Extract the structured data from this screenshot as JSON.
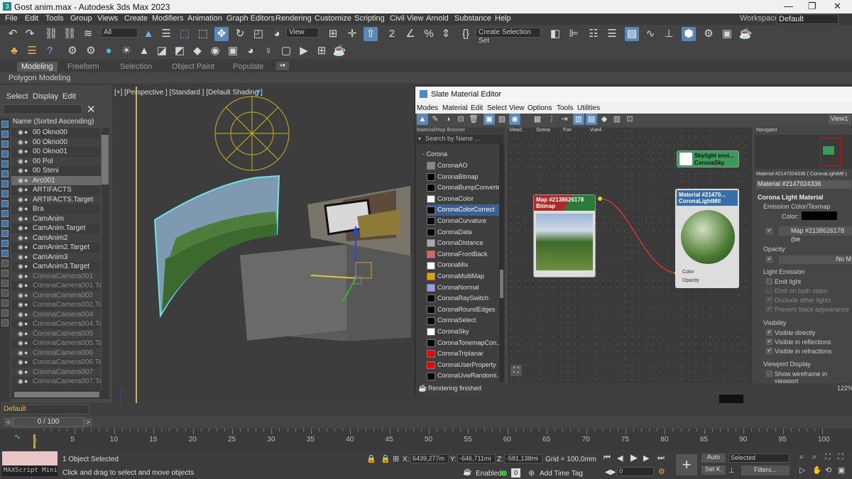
{
  "window": {
    "title": "Gost anim.max - Autodesk 3ds Max 2023",
    "minimize": "—",
    "maximize": "❐",
    "close": "✕"
  },
  "menu": [
    "File",
    "Edit",
    "Tools",
    "Group",
    "Views",
    "Create",
    "Modifiers",
    "Animation",
    "Graph Editors",
    "Rendering",
    "Customize",
    "Scripting",
    "Civil View",
    "Arnold",
    "Substance",
    "Help"
  ],
  "workspaces": {
    "label": "Workspaces:",
    "value": "Default"
  },
  "toolbar": {
    "filter_value": "All",
    "view_dropdown": "View",
    "selection_set": "Create Selection Set"
  },
  "ribbon": {
    "tabs": [
      "Modeling",
      "Freeform",
      "Selection",
      "Object Paint",
      "Populate"
    ],
    "active": "Modeling",
    "panel": "Polygon Modeling"
  },
  "scene_explorer": {
    "menu": [
      "Select",
      "Display",
      "Edit"
    ],
    "header": "Name (Sorted Ascending)",
    "items": [
      {
        "name": "00 Okno00"
      },
      {
        "name": "00 Okno00"
      },
      {
        "name": "00 Okno01"
      },
      {
        "name": "00 Pol"
      },
      {
        "name": "00 Steni"
      },
      {
        "name": "Arc001",
        "selected": true
      },
      {
        "name": "ARTIFACTS"
      },
      {
        "name": "ARTIFACTS.Target"
      },
      {
        "name": "Bra"
      },
      {
        "name": "CamAnim"
      },
      {
        "name": "CamAnim.Target"
      },
      {
        "name": "CamAnim2"
      },
      {
        "name": "CamAnim2.Target"
      },
      {
        "name": "CamAnim3"
      },
      {
        "name": "CamAnim3.Target"
      },
      {
        "name": "CoronaCamera001",
        "dim": true
      },
      {
        "name": "CoronaCamera001.Targ",
        "dim": true
      },
      {
        "name": "CoronaCamera002",
        "dim": true
      },
      {
        "name": "CoronaCamera002.Targ",
        "dim": true
      },
      {
        "name": "CoronaCamera004",
        "dim": true
      },
      {
        "name": "CoronaCamera004.Targ",
        "dim": true
      },
      {
        "name": "CoronaCamera005",
        "dim": true
      },
      {
        "name": "CoronaCamera005.Targ",
        "dim": true
      },
      {
        "name": "CoronaCamera006",
        "dim": true
      },
      {
        "name": "CoronaCamera006.Targ",
        "dim": true
      },
      {
        "name": "CoronaCamera007",
        "dim": true
      },
      {
        "name": "CoronaCamera007.Targ",
        "dim": true
      }
    ],
    "layer": "Default"
  },
  "viewport": {
    "label": "[+] [Perspective ] [Standard ] [Default Shading ]"
  },
  "slate": {
    "title": "Slate Material Editor",
    "menu": [
      "Modes",
      "Material",
      "Edit",
      "Select",
      "View",
      "Options",
      "Tools",
      "Utilities"
    ],
    "browser_title": "Material/Map Browser",
    "search_placeholder": "Search by Name ...",
    "group": "- Corona",
    "view_tabs": [
      "View1",
      "Scena",
      "Fon",
      "Vue4"
    ],
    "view_right": "View1",
    "maps": [
      {
        "name": "CoronaAO",
        "color": "#888888"
      },
      {
        "name": "CoronaBitmap",
        "color": "#000000"
      },
      {
        "name": "CoronaBumpConverter",
        "color": "#000000"
      },
      {
        "name": "CoronaColor",
        "color": "#ffffff"
      },
      {
        "name": "CoronaColorCorrect",
        "color": "#000000",
        "selected": true
      },
      {
        "name": "CoronaCurvature",
        "color": "#000000"
      },
      {
        "name": "CoronaData",
        "color": "#000000"
      },
      {
        "name": "CoronaDistance",
        "color": "#aaaaaa"
      },
      {
        "name": "CoronaFrontBack",
        "color": "#e06060"
      },
      {
        "name": "CoronaMix",
        "color": "#ffffff"
      },
      {
        "name": "CoronaMultiMap",
        "color": "#e0a000"
      },
      {
        "name": "CoronaNormal",
        "color": "#9a9ae8"
      },
      {
        "name": "CoronaRaySwitch",
        "color": "#000000"
      },
      {
        "name": "CoronaRoundEdges",
        "color": "#000000"
      },
      {
        "name": "CoronaSelect",
        "color": "#000000"
      },
      {
        "name": "CoronaSky",
        "color": "#ffffff"
      },
      {
        "name": "CoronaTonemapCon...",
        "color": "#000000"
      },
      {
        "name": "CoronaTriplanar",
        "color": "#ee0000"
      },
      {
        "name": "CoronaUserProperty",
        "color": "#ee0000"
      },
      {
        "name": "CoronaUvwRandomi...",
        "color": "#000000"
      }
    ],
    "nodes": {
      "bitmap": {
        "line1": "Map #2138626178",
        "line2": "Bitmap"
      },
      "material": {
        "line1": "Material #21470...",
        "line2": "CoronaLightMtl",
        "port1": "Color",
        "port2": "Opacity"
      },
      "sky": {
        "line1": "Skylight envi...",
        "line2": "CoronaSky"
      }
    },
    "navigator": "Navigator",
    "params": {
      "header": "Material #2147024336 ( CoronaLightMtl )",
      "name": "Material #2147024336",
      "rollout": "Corona Light Material",
      "emission": "Emission Color/Texmap",
      "color_label": "Color:",
      "map": "Map #2138626178 (be",
      "opacity": "Opacity",
      "opacity_value": "No M",
      "light_emission": "Light Emission",
      "emit_light": "Emit light",
      "emit_both": "Emit on both sides",
      "occlude": "Occlude other lights",
      "prevent_black": "Prevent black appearance",
      "visibility": "Visibility",
      "vis_direct": "Visible directly",
      "vis_refl": "Visible in reflections",
      "vis_refr": "Visible in refractions",
      "viewport_display": "Viewport Display",
      "wireframe": "Show wireframe in viewport"
    },
    "status": "Rendering finished",
    "zoom": "122%"
  },
  "timeline": {
    "frame": "0 / 100",
    "ticks": [
      "5",
      "10",
      "15",
      "20",
      "25",
      "30",
      "35",
      "40",
      "45",
      "50",
      "55",
      "60",
      "65",
      "70",
      "75",
      "80",
      "85",
      "90",
      "95",
      "100"
    ],
    "start": "0"
  },
  "status": {
    "selected": "1 Object Selected",
    "prompt": "Click and drag to select and move objects",
    "maxscript": "MAXScript Mini",
    "x_label": "X:",
    "x": "6439,277m",
    "y_label": "Y:",
    "y": "-646,711mi",
    "z_label": "Z:",
    "z": "-581,138mi",
    "grid": "Grid = 100,0mm",
    "enabled": "Enabled:",
    "add_time_tag": "Add Time Tag",
    "auto": "Auto",
    "selected_dd": "Selected",
    "setk": "Set K.",
    "filters": "Filters...",
    "frame": "0"
  }
}
